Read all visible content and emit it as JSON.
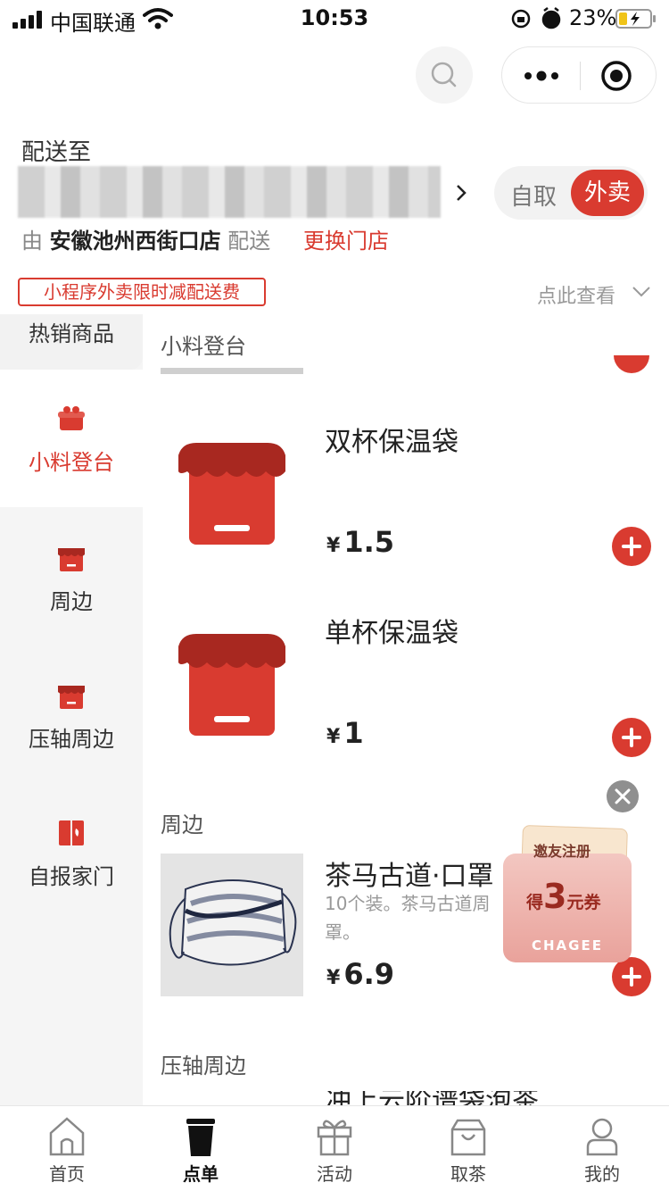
{
  "status_bar": {
    "carrier": "中国联通",
    "time": "10:53",
    "battery": "23%"
  },
  "delivery": {
    "deliver_to_label": "配送至",
    "mode_pickup": "自取",
    "mode_delivery": "外卖",
    "store_prefix": "由",
    "store_name": "安徽池州西街口店",
    "store_suffix": "配送",
    "change_store": "更换门店",
    "promo_tag": "小程序外卖限时减配送费",
    "view_more": "点此查看"
  },
  "sidebar": {
    "items": [
      {
        "label": "热销商品",
        "icon": "hot-icon"
      },
      {
        "label": "小料登台",
        "icon": "gift-box-icon"
      },
      {
        "label": "周边",
        "icon": "shop-box-icon"
      },
      {
        "label": "压轴周边",
        "icon": "shop-box-icon"
      },
      {
        "label": "自报家门",
        "icon": "door-icon"
      }
    ]
  },
  "sections": {
    "xl": "小料登台",
    "zb": "周边",
    "yz": "压轴周边"
  },
  "products": [
    {
      "name": "双杯保温袋",
      "currency": "¥",
      "price": "1.5"
    },
    {
      "name": "单杯保温袋",
      "currency": "¥",
      "price": "1"
    },
    {
      "name": "茶马古道·口罩",
      "currency": "¥",
      "price": "6.9",
      "desc": "10个装。茶马古道周罩。"
    }
  ],
  "next_item_partial": "冲上云阶谱袋泡茶",
  "coupon": {
    "line1": "邀友注册",
    "prefix": "得",
    "amount": "3",
    "suffix": "元券",
    "brand": "CHAGEE"
  },
  "tabbar": {
    "items": [
      {
        "label": "首页",
        "icon": "home-icon"
      },
      {
        "label": "点单",
        "icon": "cup-icon"
      },
      {
        "label": "活动",
        "icon": "gift-icon"
      },
      {
        "label": "取茶",
        "icon": "bag-icon"
      },
      {
        "label": "我的",
        "icon": "user-icon"
      }
    ],
    "active": "点单"
  },
  "colors": {
    "accent": "#d93b30",
    "sidebar_bg": "#f5f5f5"
  }
}
